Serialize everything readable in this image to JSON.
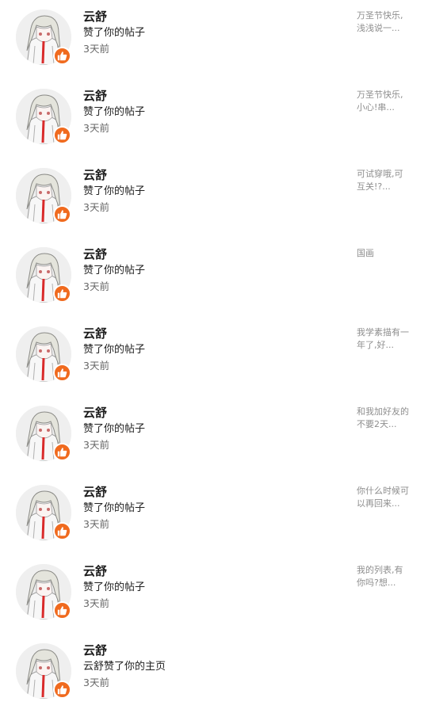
{
  "accent_color": "#f06a1e",
  "badge_icon": "thumbs-up-icon",
  "notifications": [
    {
      "name": "云舒",
      "action": "赞了你的帖子",
      "time": "3天前",
      "preview": [
        "万圣节快乐,",
        "浅浅说一..."
      ]
    },
    {
      "name": "云舒",
      "action": "赞了你的帖子",
      "time": "3天前",
      "preview": [
        "万圣节快乐,",
        "小心!串..."
      ]
    },
    {
      "name": "云舒",
      "action": "赞了你的帖子",
      "time": "3天前",
      "preview": [
        "可试穿哦,可",
        "互关!?..."
      ]
    },
    {
      "name": "云舒",
      "action": "赞了你的帖子",
      "time": "3天前",
      "preview": [
        "国画"
      ]
    },
    {
      "name": "云舒",
      "action": "赞了你的帖子",
      "time": "3天前",
      "preview": [
        "我学素描有一",
        "年了,好..."
      ]
    },
    {
      "name": "云舒",
      "action": "赞了你的帖子",
      "time": "3天前",
      "preview": [
        "和我加好友的",
        "不要2天..."
      ]
    },
    {
      "name": "云舒",
      "action": "赞了你的帖子",
      "time": "3天前",
      "preview": [
        "你什么时候可",
        "以再回来..."
      ]
    },
    {
      "name": "云舒",
      "action": "赞了你的帖子",
      "time": "3天前",
      "preview": [
        "我的列表,有",
        "你吗?想..."
      ]
    },
    {
      "name": "云舒",
      "action": "云舒赞了你的主页",
      "time": "3天前",
      "preview": []
    }
  ]
}
